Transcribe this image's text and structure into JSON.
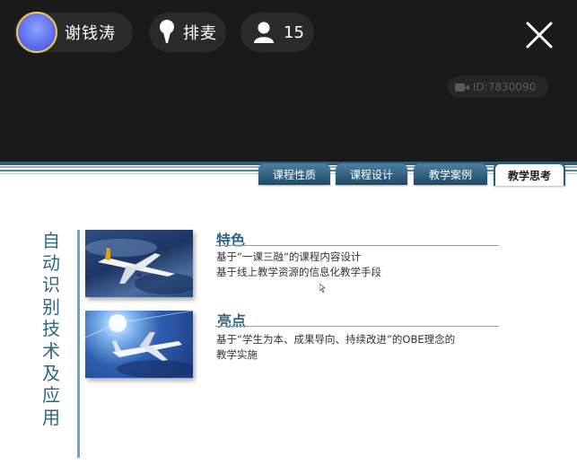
{
  "header": {
    "host_name": "谢钱涛",
    "avatar_text": "",
    "mic_label": "排麦",
    "viewer_count": "15",
    "room_id": "ID:7830090"
  },
  "slide": {
    "tabs": [
      {
        "label": "课程性质",
        "active": false
      },
      {
        "label": "课程设计",
        "active": false
      },
      {
        "label": "教学案例",
        "active": false
      },
      {
        "label": "教学思考",
        "active": true
      }
    ],
    "vertical_title": [
      "自",
      "动",
      "识",
      "别",
      "技",
      "术",
      "及",
      "应",
      "用"
    ],
    "sections": [
      {
        "title": "特色",
        "lines": [
          "基于“一课三融“的课程内容设计",
          "基于线上教学资源的信息化教学手段"
        ]
      },
      {
        "title": "亮点",
        "lines": [
          "基于“学生为本、成果导向、持续改进”的OBE理念的",
          "教学实施"
        ]
      }
    ]
  },
  "colors": {
    "accent": "#2f6584",
    "tab_dark": "#1d4a67",
    "background_top": "#1a1a1a"
  }
}
